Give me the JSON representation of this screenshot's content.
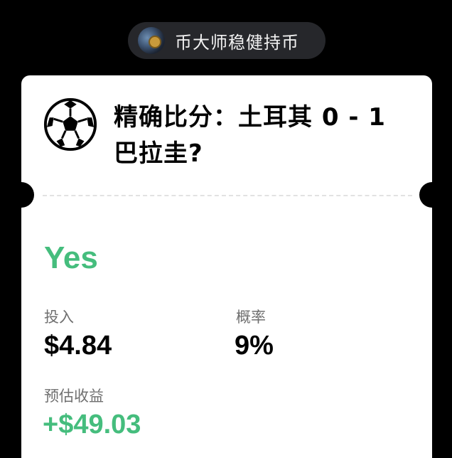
{
  "user": {
    "name": "币大师稳健持币"
  },
  "market": {
    "title": "精确比分：土耳其 0 - 1 巴拉圭?",
    "outcome": "Yes"
  },
  "stats": {
    "stake_label": "投入",
    "stake_value": "$4.84",
    "probability_label": "概率",
    "probability_value": "9%",
    "payout_label": "预估收益",
    "payout_value": "+$49.03"
  },
  "colors": {
    "accent_green": "#45bd7d",
    "background": "#000000",
    "card": "#ffffff",
    "pill": "#26272b"
  },
  "icons": {
    "market_icon": "soccer-ball-icon"
  }
}
